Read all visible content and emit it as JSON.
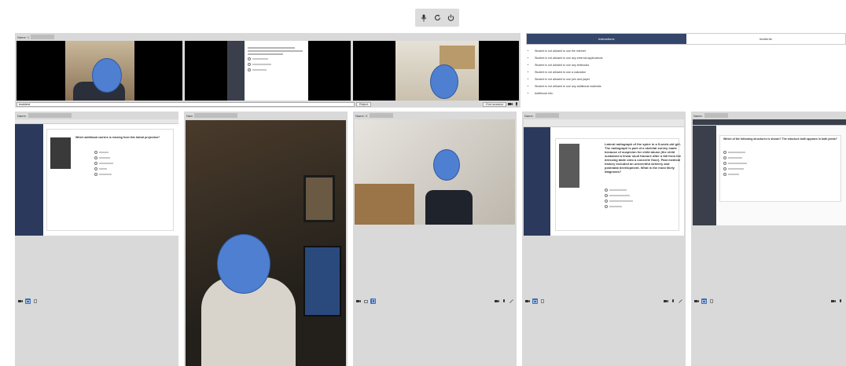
{
  "toolbar": {
    "icons": [
      "microphone-icon",
      "refresh-icon",
      "power-icon"
    ]
  },
  "featured": {
    "name_label": "Name: 1",
    "input_value": "Incident",
    "reject_label": "Reject",
    "end_session_label": "End session"
  },
  "instructions": {
    "tabs": [
      "Instructions",
      "Incidents"
    ],
    "active_tab": "Instructions",
    "rules": [
      "Student is not allowed to use the internet",
      "Student is not allowed to use any external applications",
      "Student is not allowed to use any textbooks",
      "Student is not allowed to use a calculator",
      "Student is not allowed to use pen and paper",
      "Student is not allowed to use any additional materials",
      "Additional info:"
    ]
  },
  "tiles": [
    {
      "name_label": "Name:",
      "icons": [
        "camera-icon",
        "screen-icon",
        "expand-icon"
      ],
      "screen_question": "Which additional carriers is missing from this lateral projection?"
    },
    {
      "name_label": "Nam",
      "icons": []
    },
    {
      "name_label": "Name: V",
      "icons": [
        "camera-icon",
        "screen-icon",
        "screen-badge-icon"
      ]
    },
    {
      "name_label": "Name:",
      "icons": [
        "camera-icon",
        "screen-icon",
        "expand-icon"
      ],
      "screen_question": "Lateral radiograph of the spine in a 5-week-old girl. The radiograph is part of a skeletal survey made because of suspicion for child abuse (the child sustained a linear skull fracture after a fall from the dressing table onto a concrete floor). Past medical history included an uneventful delivery and postnatal development. What is the most likely diagnosis?"
    },
    {
      "name_label": "Name:",
      "icons": [
        "camera-icon",
        "screen-icon",
        "expand-icon"
      ],
      "screen_question": "Which of the following structures is shown? The structure both appears in both joints?"
    }
  ]
}
